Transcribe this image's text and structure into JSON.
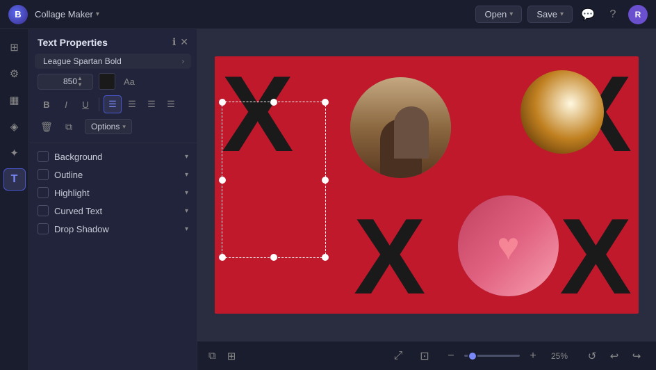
{
  "app": {
    "name": "Collage Maker",
    "logo_letter": "B"
  },
  "topbar": {
    "app_name": "Collage Maker",
    "open_label": "Open",
    "save_label": "Save",
    "user_initial": "R"
  },
  "sidebar_icons": [
    {
      "name": "layout-icon",
      "symbol": "⊞",
      "active": false
    },
    {
      "name": "adjustments-icon",
      "symbol": "⚙",
      "active": false
    },
    {
      "name": "grid-icon",
      "symbol": "▦",
      "active": false
    },
    {
      "name": "shapes-icon",
      "symbol": "◈",
      "active": false
    },
    {
      "name": "elements-icon",
      "symbol": "✦",
      "active": false
    },
    {
      "name": "text-icon",
      "symbol": "T",
      "active": true
    }
  ],
  "properties_panel": {
    "title": "Text Properties",
    "font": {
      "name": "League Spartan Bold"
    },
    "size": {
      "value": "850",
      "unit": "px"
    },
    "color": "#1a1a1a",
    "format_buttons": [
      {
        "name": "bold-btn",
        "symbol": "B",
        "active": false
      },
      {
        "name": "italic-btn",
        "symbol": "I",
        "active": false
      },
      {
        "name": "underline-btn",
        "symbol": "U",
        "active": false
      },
      {
        "name": "align-left-btn",
        "symbol": "≡",
        "active": true
      },
      {
        "name": "align-center-btn",
        "symbol": "≡",
        "active": false
      },
      {
        "name": "align-right-btn",
        "symbol": "≡",
        "active": false
      },
      {
        "name": "align-justify-btn",
        "symbol": "≡",
        "active": false
      }
    ],
    "options_label": "Options",
    "properties": [
      {
        "name": "background-prop",
        "label": "Background",
        "checked": false
      },
      {
        "name": "outline-prop",
        "label": "Outline",
        "checked": false
      },
      {
        "name": "highlight-prop",
        "label": "Highlight",
        "checked": false
      },
      {
        "name": "curved-text-prop",
        "label": "Curved Text",
        "checked": false
      },
      {
        "name": "drop-shadow-prop",
        "label": "Drop Shadow",
        "checked": false
      }
    ]
  },
  "canvas": {
    "bg_color": "#c0192c",
    "x_letters": [
      "X",
      "X",
      "X",
      "X"
    ],
    "zoom_percent": "25%",
    "zoom_value": 25
  },
  "bottom_bar": {
    "zoom_label": "25%"
  }
}
